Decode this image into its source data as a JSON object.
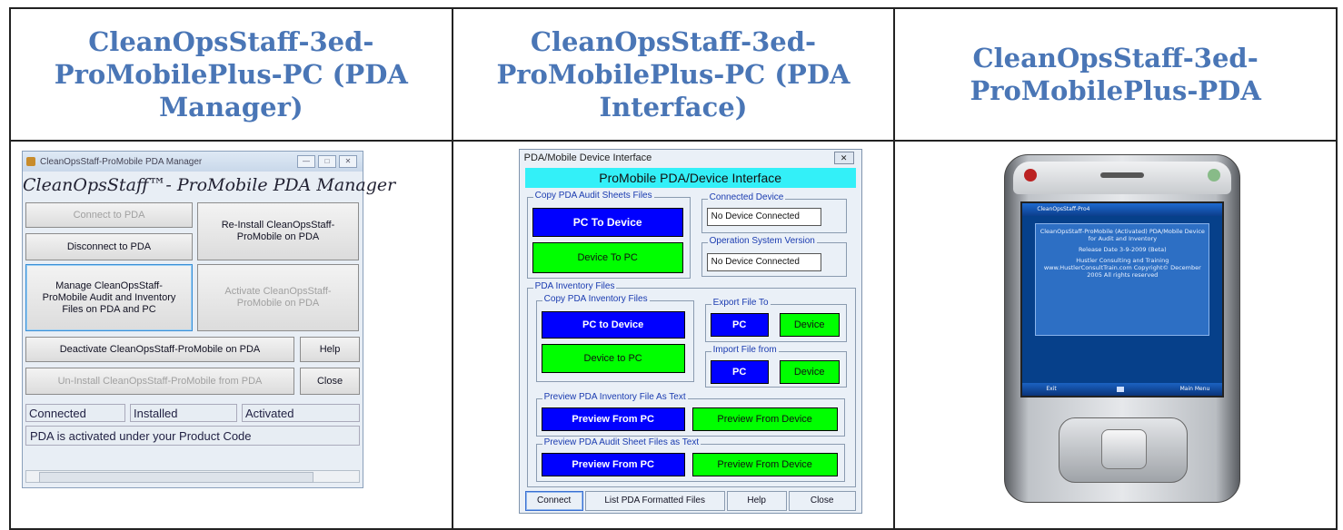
{
  "headers": [
    "CleanOpsStaff-3ed-ProMobilePlus-PC (PDA Manager)",
    "CleanOpsStaff-3ed-ProMobilePlus-PC (PDA Interface)",
    "CleanOpsStaff-3ed-ProMobilePlus-PDA"
  ],
  "manager": {
    "window_title": "CleanOpsStaff-ProMobile PDA Manager",
    "heading": "CleanOpsStaff™- ProMobile PDA Manager",
    "connect": "Connect to PDA",
    "disconnect": "Disconnect to PDA",
    "reinstall": "Re-Install CleanOpsStaff-ProMobile on PDA",
    "manage": "Manage CleanOpsStaff-ProMobile Audit and Inventory Files on PDA and PC",
    "activate": "Activate CleanOpsStaff-ProMobile on PDA",
    "deactivate": "Deactivate CleanOpsStaff-ProMobile on PDA",
    "help": "Help",
    "uninstall": "Un-Install CleanOpsStaff-ProMobile from PDA",
    "close": "Close",
    "status_connected": "Connected",
    "status_installed": "Installed",
    "status_activated": "Activated",
    "message": "PDA is activated under your Product Code"
  },
  "interface": {
    "window_title": "PDA/Mobile Device Interface",
    "banner": "ProMobile PDA/Device Interface",
    "audit_group": "Copy PDA Audit Sheets Files",
    "pc_to_device": "PC To Device",
    "device_to_pc": "Device To PC",
    "connected_group": "Connected Device",
    "connected_value": "No Device Connected",
    "os_group": "Operation System Version",
    "os_value": "No Device Connected",
    "inventory_group": "PDA Inventory Files",
    "copy_inventory_group": "Copy PDA Inventory Files",
    "inv_pc_to_device": "PC to Device",
    "inv_device_to_pc": "Device to PC",
    "export_group": "Export File To",
    "import_group": "Import File from",
    "pc": "PC",
    "device": "Device",
    "preview_inventory_group": "Preview PDA Inventory File As Text",
    "preview_audit_group": "Preview PDA Audit Sheet Files as Text",
    "preview_from_pc": "Preview From PC",
    "preview_from_device": "Preview From Device",
    "btn_connect": "Connect",
    "btn_list": "List PDA Formatted Files",
    "btn_help": "Help",
    "btn_close": "Close"
  },
  "device": {
    "title_bar": "CleanOpsStaff-Pro4",
    "line1": "CleanOpsStaff-ProMobile (Activated) PDA/Mobile Device for Audit and Inventory",
    "line2": "Release Date 3-9-2009 (Beta)",
    "line3": "Hustler Consulting and Training www.HustlerConsultTrain.com Copyright© December 2005 All rights reserved",
    "menu_left": "Exit",
    "menu_right": "Main Menu"
  },
  "colors": {
    "header_text": "#4a76b6",
    "blue_button": "#0000ff",
    "green_button": "#00ff00",
    "banner": "#33f0f8"
  }
}
